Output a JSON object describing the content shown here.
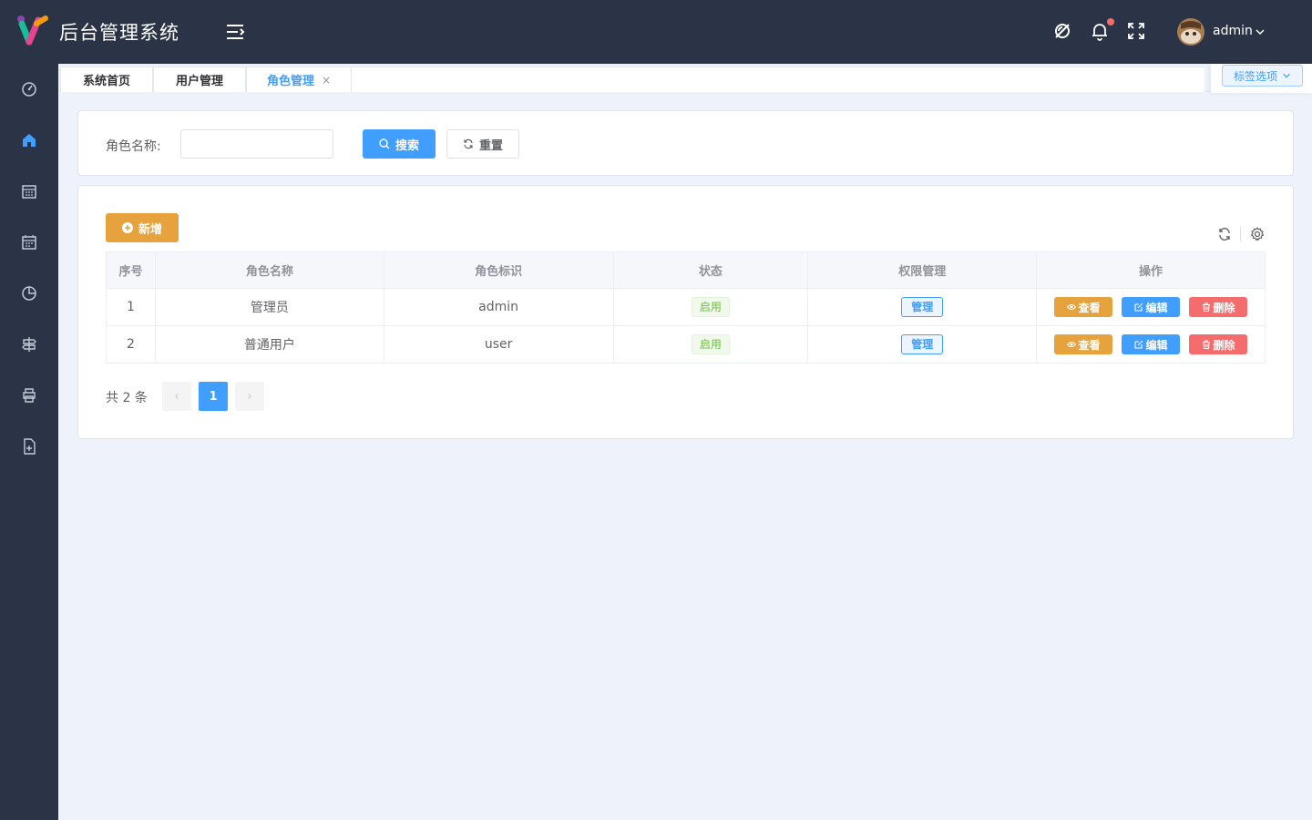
{
  "header": {
    "title": "后台管理系统",
    "username": "admin",
    "icons": [
      "logo-icon",
      "menu-collapse-icon",
      "theme-off-icon",
      "bell-icon",
      "fullscreen-icon",
      "chevron-down-icon"
    ]
  },
  "sidebar": {
    "items": [
      {
        "icon": "dashboard-icon"
      },
      {
        "icon": "home-icon",
        "active": true
      },
      {
        "icon": "calendar-icon"
      },
      {
        "icon": "calendar-grid-icon"
      },
      {
        "icon": "pie-chart-icon"
      },
      {
        "icon": "signpost-icon"
      },
      {
        "icon": "printer-icon"
      },
      {
        "icon": "document-add-icon"
      }
    ]
  },
  "tabs": {
    "items": [
      {
        "label": "系统首页"
      },
      {
        "label": "用户管理"
      },
      {
        "label": "角色管理",
        "active": true
      }
    ],
    "close_symbol": "×",
    "options_label": "标签选项"
  },
  "search": {
    "label": "角色名称:",
    "input_value": "",
    "search_label": "搜索",
    "reset_label": "重置"
  },
  "toolbar": {
    "add_label": "新增"
  },
  "table": {
    "columns": [
      "序号",
      "角色名称",
      "角色标识",
      "状态",
      "权限管理",
      "操作"
    ],
    "rows": [
      {
        "index": "1",
        "name": "管理员",
        "key": "admin",
        "status": "启用",
        "perm": "管理",
        "view": "查看",
        "edit": "编辑",
        "del": "删除"
      },
      {
        "index": "2",
        "name": "普通用户",
        "key": "user",
        "status": "启用",
        "perm": "管理",
        "view": "查看",
        "edit": "编辑",
        "del": "删除"
      }
    ]
  },
  "pagination": {
    "total": "共 2 条",
    "current": "1",
    "prev": "‹",
    "next": "›"
  },
  "colors": {
    "header_bg": "#2b3446",
    "primary": "#409eff",
    "warning": "#e6a23c",
    "danger": "#f56c6c",
    "success": "#67c23a",
    "page_bg": "#eef2fa"
  }
}
